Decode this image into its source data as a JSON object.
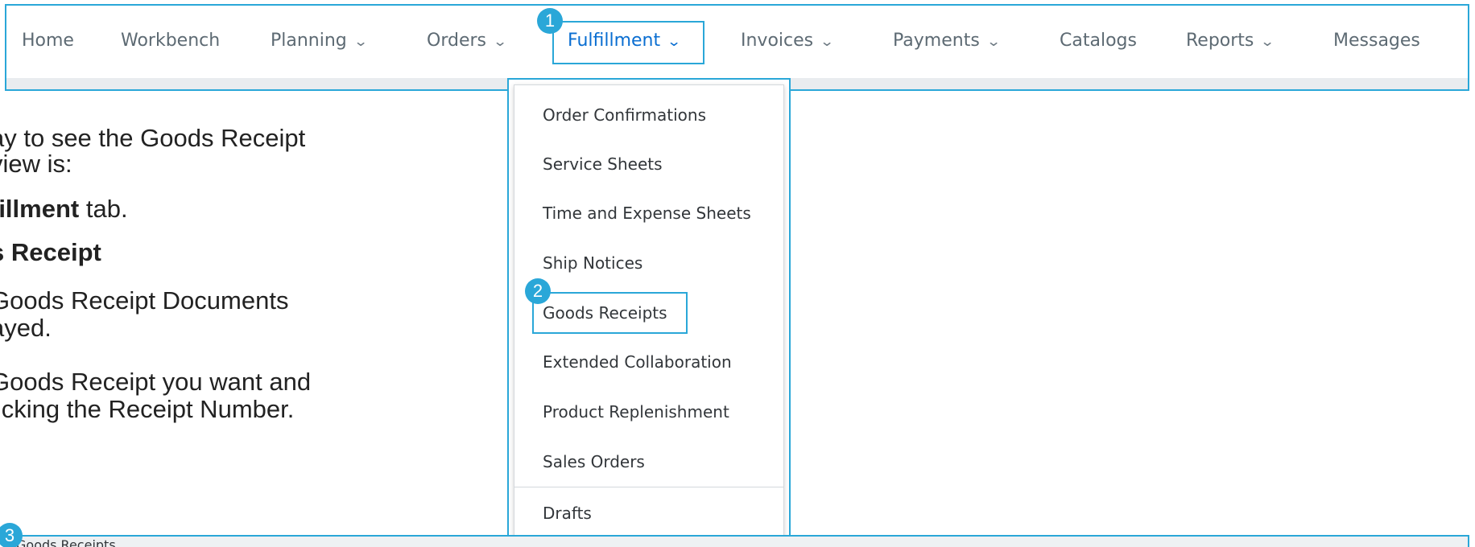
{
  "nav": {
    "items": [
      {
        "label": "Home",
        "has_dropdown": false
      },
      {
        "label": "Workbench",
        "has_dropdown": false
      },
      {
        "label": "Planning",
        "has_dropdown": true
      },
      {
        "label": "Orders",
        "has_dropdown": true
      },
      {
        "label": "Fulfillment",
        "has_dropdown": true,
        "active": true
      },
      {
        "label": "Invoices",
        "has_dropdown": true
      },
      {
        "label": "Payments",
        "has_dropdown": true
      },
      {
        "label": "Catalogs",
        "has_dropdown": false
      },
      {
        "label": "Reports",
        "has_dropdown": true
      },
      {
        "label": "Messages",
        "has_dropdown": false
      }
    ],
    "chevron_icon": "chevron-down-icon"
  },
  "dropdown": {
    "items": [
      {
        "label": "Order Confirmations"
      },
      {
        "label": "Service Sheets"
      },
      {
        "label": "Time and Expense Sheets"
      },
      {
        "label": "Ship Notices"
      },
      {
        "label": "Goods Receipts",
        "highlighted": true
      },
      {
        "label": "Extended Collaboration"
      },
      {
        "label": "Product Replenishment"
      },
      {
        "label": "Sales Orders"
      },
      {
        "label": "Drafts"
      }
    ]
  },
  "instructions": {
    "line1": "ay to see the Goods Receipt",
    "line2": "view is:",
    "line3_bold": "fillment",
    "line3_rest": " tab.",
    "line4_bold": "s Receipt",
    "line5": "Goods Receipt Documents",
    "line6": "ayed.",
    "line7": "Goods Receipt you want and",
    "line8": "licking the Receipt Number."
  },
  "badges": {
    "step1": "1",
    "step2": "2",
    "step3": "3"
  },
  "bottom": {
    "title": "Goods Receipts"
  },
  "colors": {
    "highlight": "#2aa7d8",
    "active_link": "#0a6ed1",
    "nav_text": "#5d6a73"
  }
}
